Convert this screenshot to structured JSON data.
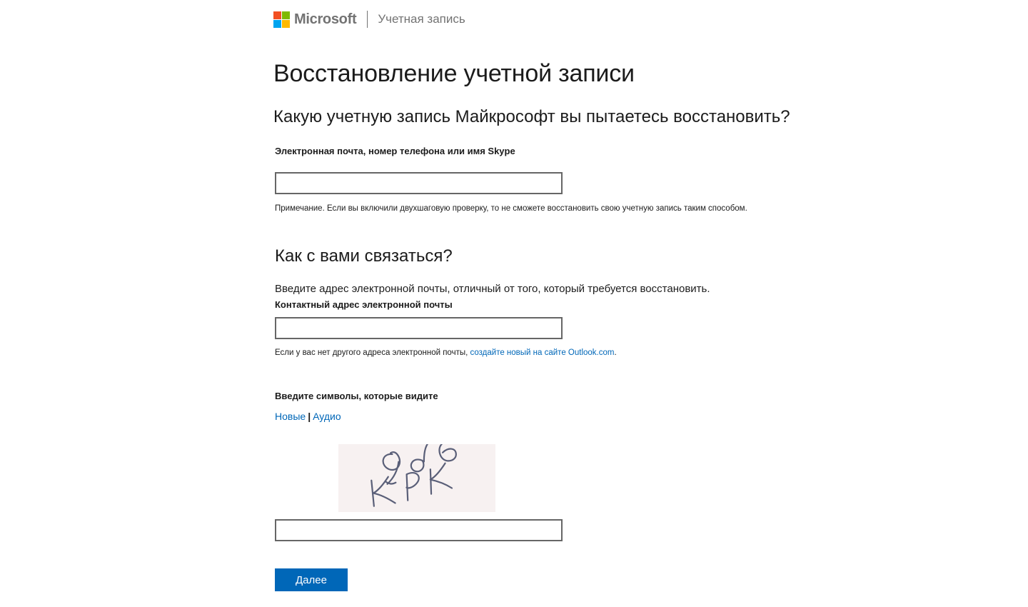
{
  "header": {
    "brand": "Microsoft",
    "section": "Учетная запись",
    "logo_colors": [
      "#f25022",
      "#7fba00",
      "#00a4ef",
      "#ffb900"
    ]
  },
  "page_title": "Восстановление учетной записи",
  "account_section": {
    "heading": "Какую учетную запись Майкрософт вы пытаетесь восстановить?",
    "field_label": "Электронная почта, номер телефона или имя Skype",
    "field_value": "",
    "note": "Примечание. Если вы включили двухшаговую проверку, то не сможете восстановить свою учетную запись таким способом."
  },
  "contact_section": {
    "heading": "Как с вами связаться?",
    "intro": "Введите адрес электронной почты, отличный от того, который требуется восстановить.",
    "field_label": "Контактный адрес электронной почты",
    "field_value": "",
    "note_prefix": "Если у вас нет другого адреса электронной почты,",
    "note_link": "создайте новый на сайте Outlook.com",
    "note_suffix": "."
  },
  "captcha_section": {
    "label": "Введите символы, которые видите",
    "new_link": "Новые",
    "separator": "|",
    "audio_link": "Аудио",
    "image_text": "Qd6 KPK",
    "field_value": ""
  },
  "next_button": "Далее",
  "colors": {
    "accent": "#0067b8",
    "text": "#1b1b1b",
    "muted": "#737373"
  }
}
